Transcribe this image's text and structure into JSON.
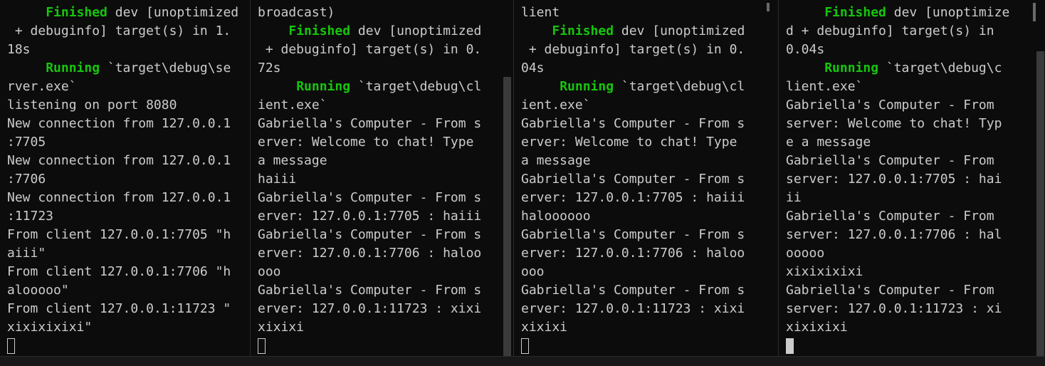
{
  "panes": [
    {
      "name": "server-pane",
      "lines": [
        [
          {
            "t": "     "
          },
          {
            "t": "Finished",
            "k": 1
          },
          {
            "t": " dev [unoptimized"
          }
        ],
        [
          {
            "t": " + debuginfo] target(s) in 1."
          }
        ],
        [
          {
            "t": "18s"
          }
        ],
        [
          {
            "t": "     "
          },
          {
            "t": "Running",
            "k": 1
          },
          {
            "t": " `target\\debug\\se"
          }
        ],
        [
          {
            "t": "rver.exe`"
          }
        ],
        [
          {
            "t": "listening on port 8080"
          }
        ],
        [
          {
            "t": "New connection from 127.0.0.1"
          }
        ],
        [
          {
            "t": ":7705"
          }
        ],
        [
          {
            "t": "New connection from 127.0.0.1"
          }
        ],
        [
          {
            "t": ":7706"
          }
        ],
        [
          {
            "t": "New connection from 127.0.0.1"
          }
        ],
        [
          {
            "t": ":11723"
          }
        ],
        [
          {
            "t": "From client 127.0.0.1:7705 \"h"
          }
        ],
        [
          {
            "t": "aiii\""
          }
        ],
        [
          {
            "t": "From client 127.0.0.1:7706 \"h"
          }
        ],
        [
          {
            "t": "alooooo\""
          }
        ],
        [
          {
            "t": "From client 127.0.0.1:11723 \""
          }
        ],
        [
          {
            "t": "xixixixixi\""
          }
        ]
      ],
      "cursor": "outline"
    },
    {
      "name": "client-pane-1",
      "lines": [
        [
          {
            "t": "broadcast)"
          }
        ],
        [
          {
            "t": "    "
          },
          {
            "t": "Finished",
            "k": 1
          },
          {
            "t": " dev [unoptimized"
          }
        ],
        [
          {
            "t": " + debuginfo] target(s) in 0."
          }
        ],
        [
          {
            "t": "72s"
          }
        ],
        [
          {
            "t": "     "
          },
          {
            "t": "Running",
            "k": 1
          },
          {
            "t": " `target\\debug\\cl"
          }
        ],
        [
          {
            "t": "ient.exe`"
          }
        ],
        [
          {
            "t": "Gabriella's Computer - From s"
          }
        ],
        [
          {
            "t": "erver: Welcome to chat! Type"
          }
        ],
        [
          {
            "t": "a message"
          }
        ],
        [
          {
            "t": "haiii"
          }
        ],
        [
          {
            "t": "Gabriella's Computer - From s"
          }
        ],
        [
          {
            "t": "erver: 127.0.0.1:7705 : haiii"
          }
        ],
        [
          {
            "t": "Gabriella's Computer - From s"
          }
        ],
        [
          {
            "t": "erver: 127.0.0.1:7706 : haloo"
          }
        ],
        [
          {
            "t": "ooo"
          }
        ],
        [
          {
            "t": "Gabriella's Computer - From s"
          }
        ],
        [
          {
            "t": "erver: 127.0.0.1:11723 : xixi"
          }
        ],
        [
          {
            "t": "xixixi"
          }
        ]
      ],
      "cursor": "outline"
    },
    {
      "name": "client-pane-2",
      "lines": [
        [
          {
            "t": "lient"
          }
        ],
        [
          {
            "t": "    "
          },
          {
            "t": "Finished",
            "k": 1
          },
          {
            "t": " dev [unoptimized"
          }
        ],
        [
          {
            "t": " + debuginfo] target(s) in 0."
          }
        ],
        [
          {
            "t": "04s"
          }
        ],
        [
          {
            "t": "     "
          },
          {
            "t": "Running",
            "k": 1
          },
          {
            "t": " `target\\debug\\cl"
          }
        ],
        [
          {
            "t": "ient.exe`"
          }
        ],
        [
          {
            "t": "Gabriella's Computer - From s"
          }
        ],
        [
          {
            "t": "erver: Welcome to chat! Type"
          }
        ],
        [
          {
            "t": "a message"
          }
        ],
        [
          {
            "t": "Gabriella's Computer - From s"
          }
        ],
        [
          {
            "t": "erver: 127.0.0.1:7705 : haiii"
          }
        ],
        [
          {
            "t": "haloooooo"
          }
        ],
        [
          {
            "t": "Gabriella's Computer - From s"
          }
        ],
        [
          {
            "t": "erver: 127.0.0.1:7706 : haloo"
          }
        ],
        [
          {
            "t": "ooo"
          }
        ],
        [
          {
            "t": "Gabriella's Computer - From s"
          }
        ],
        [
          {
            "t": "erver: 127.0.0.1:11723 : xixi"
          }
        ],
        [
          {
            "t": "xixixi"
          }
        ]
      ],
      "cursor": "outline"
    },
    {
      "name": "client-pane-3",
      "lines": [
        [
          {
            "t": "     "
          },
          {
            "t": "Finished",
            "k": 1
          },
          {
            "t": " dev [unoptimize"
          }
        ],
        [
          {
            "t": "d + debuginfo] target(s) in"
          }
        ],
        [
          {
            "t": "0.04s"
          }
        ],
        [
          {
            "t": "     "
          },
          {
            "t": "Running",
            "k": 1
          },
          {
            "t": " `target\\debug\\c"
          }
        ],
        [
          {
            "t": "lient.exe`"
          }
        ],
        [
          {
            "t": "Gabriella's Computer - From"
          }
        ],
        [
          {
            "t": "server: Welcome to chat! Typ"
          }
        ],
        [
          {
            "t": "e a message"
          }
        ],
        [
          {
            "t": "Gabriella's Computer - From"
          }
        ],
        [
          {
            "t": "server: 127.0.0.1:7705 : hai"
          }
        ],
        [
          {
            "t": "ii"
          }
        ],
        [
          {
            "t": "Gabriella's Computer - From"
          }
        ],
        [
          {
            "t": "server: 127.0.0.1:7706 : hal"
          }
        ],
        [
          {
            "t": "ooooo"
          }
        ],
        [
          {
            "t": "xixixixixi"
          }
        ],
        [
          {
            "t": "Gabriella's Computer - From"
          }
        ],
        [
          {
            "t": "server: 127.0.0.1:11723 : xi"
          }
        ],
        [
          {
            "t": "xixixixi"
          }
        ]
      ],
      "cursor": "solid"
    }
  ],
  "colors": {
    "background": "#0c0c0c",
    "text": "#cccccc",
    "keyword": "#16c60c"
  }
}
